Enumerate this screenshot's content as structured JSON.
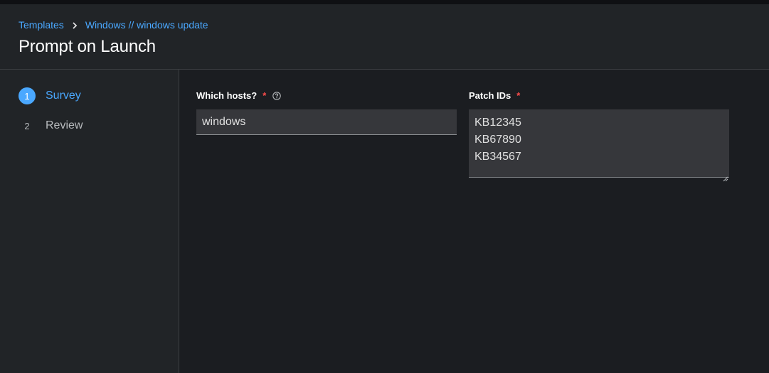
{
  "breadcrumb": {
    "items": [
      {
        "label": "Templates"
      },
      {
        "label": "Windows // windows update"
      }
    ]
  },
  "page": {
    "title": "Prompt on Launch"
  },
  "wizard": {
    "steps": [
      {
        "number": "1",
        "label": "Survey",
        "active": true
      },
      {
        "number": "2",
        "label": "Review",
        "active": false
      }
    ]
  },
  "form": {
    "hosts": {
      "label": "Which hosts?",
      "required_marker": "*",
      "value": "windows"
    },
    "patch_ids": {
      "label": "Patch IDs",
      "required_marker": "*",
      "lines": [
        "KB12345",
        "KB67890",
        "KB34567"
      ]
    }
  },
  "colors": {
    "accent": "#4aa8ff",
    "required": "#ff4d4d",
    "background": "#1b1d21",
    "panel": "#212427",
    "input_bg": "#36373b"
  },
  "icons": {
    "breadcrumb_separator": "chevron-right-icon",
    "help": "question-circle-icon",
    "resize": "resize-grip-icon"
  }
}
